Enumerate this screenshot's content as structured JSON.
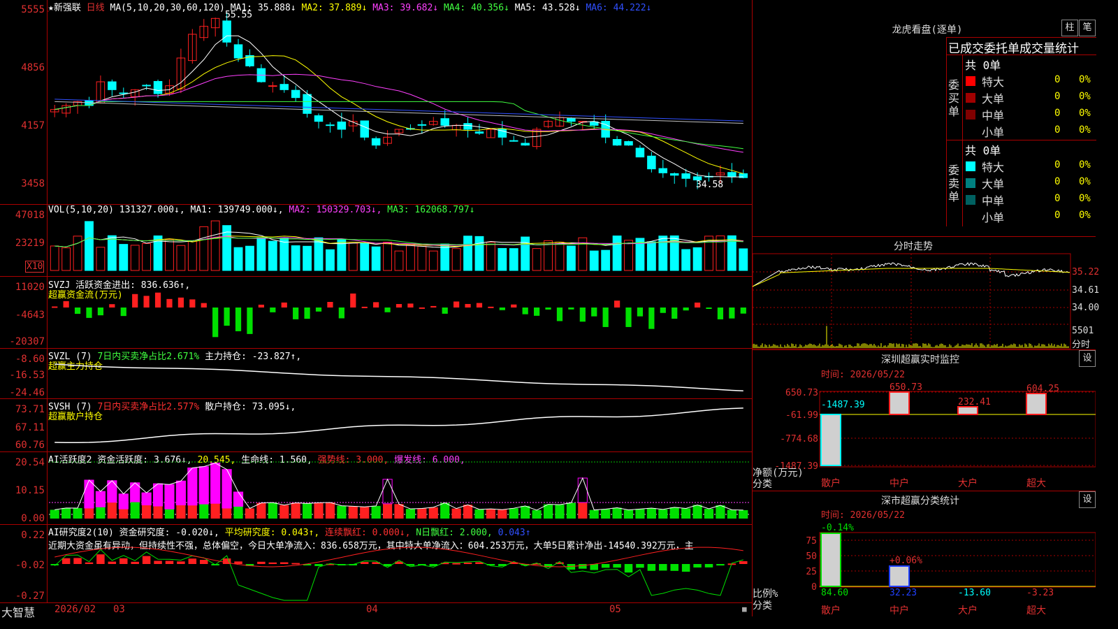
{
  "main_chart": {
    "stock_name": "★新强联",
    "period": "日线",
    "ma_header": "MA(5,10,20,30,60,120)",
    "ma1": "MA1: 35.888↓",
    "ma2": "MA2: 37.889↓",
    "ma3": "MA3: 39.682↓",
    "ma4": "MA4: 40.356↓",
    "ma5": "MA5: 43.528↓",
    "ma6": "MA6: 44.222↓",
    "y_ticks": [
      "5555",
      "4856",
      "4157",
      "3458"
    ],
    "high_label": "55.55",
    "low_label": "34.58"
  },
  "vol_panel": {
    "header": "VOL(5,10,20) 131327.000↓,",
    "ma1": "MA1: 139749.000↓,",
    "ma2": "MA2: 150329.703↓,",
    "ma3": "MA3: 162068.797↓",
    "y_ticks": [
      "47018",
      "23219"
    ],
    "unit": "X10"
  },
  "svzj_panel": {
    "header": "SVZJ  活跃资金进出: 836.636↑,",
    "sub": "超赢资金流(万元)",
    "y_ticks": [
      "11020",
      "-4643",
      "-20307"
    ]
  },
  "svzl_panel": {
    "header_prefix": "SVZL (7)",
    "header_green": "7日内买卖净占比2.671%",
    "header_white": "主力持仓: -23.827↑,",
    "sub": "超赢主力持仓",
    "y_ticks": [
      "-8.60",
      "-16.53",
      "-24.46"
    ]
  },
  "svsh_panel": {
    "header_prefix": "SVSH (7)",
    "header_red": "7日内买卖净占比2.577%",
    "header_white": "散户持仓: 73.095↓,",
    "sub": "超赢散户持仓",
    "y_ticks": [
      "73.71",
      "67.11",
      "60.76"
    ]
  },
  "ai_active_panel": {
    "header": "AI活跃度2 资金活跃度: 3.676↓,",
    "val2": "20.545,",
    "life": "生命线: 1.560,",
    "strong": "强势线: 3.000,",
    "burst": "爆发线: 6.000,",
    "y_ticks": [
      "20.54",
      "10.15",
      "0.00"
    ]
  },
  "ai_research_panel": {
    "header": "AI研究度2(10) 资金研究度: -0.020↓,",
    "avg": "平均研究度: 0.043↑,",
    "streak": "连续飘红: 0.000↓,",
    "nday": "N日飘红: 2.000,",
    "last": "0.043↑",
    "comment": "近期大资金虽有异动，但持续性不强，总体偏空，今日大单净流入：836.658万元，其中特大单净流入：604.253万元，大单5日累计净出-14540.392万元，主",
    "y_ticks": [
      "0.22",
      "-0.02",
      "-0.27"
    ]
  },
  "bottom_bar": {
    "brand": "大智慧",
    "date1": "2026/02",
    "date2": "03",
    "date3": "04",
    "date4": "05"
  },
  "right_panel": {
    "lhb_title": "龙虎看盘(逐单)",
    "btn_zhu": "柱",
    "btn_bi": "笔",
    "stats_title": "已成交委托单成交量统计",
    "buy_group_label": "委买单",
    "sell_group_label": "委卖单",
    "buy_total": "共 0单",
    "sell_total": "共 0单",
    "buy_rows": [
      {
        "label": "特大",
        "count": "0",
        "pct": "0%"
      },
      {
        "label": "大单",
        "count": "0",
        "pct": "0%"
      },
      {
        "label": "中单",
        "count": "0",
        "pct": "0%"
      },
      {
        "label": "小单",
        "count": "0",
        "pct": "0%"
      }
    ],
    "sell_rows": [
      {
        "label": "特大",
        "count": "0",
        "pct": "0%"
      },
      {
        "label": "大单",
        "count": "0",
        "pct": "0%"
      },
      {
        "label": "中单",
        "count": "0",
        "pct": "0%"
      },
      {
        "label": "小单",
        "count": "0",
        "pct": "0%"
      }
    ],
    "intraday_title": "分时走势",
    "intraday_y": [
      "35.22",
      "34.61",
      "34.00"
    ],
    "intraday_vol": "5501",
    "intraday_vol_unit": "分时",
    "sz_monitor_title": "深圳超赢实时监控",
    "sz_monitor_btn": "设",
    "sz_monitor_time": "时间: 2026/05/22",
    "sz_monitor_y": [
      "650.73",
      "-61.99",
      "-774.68",
      "-1487.39"
    ],
    "sz_monitor_axis_label": "净额(万元)",
    "sz_monitor_cat_label": "分类",
    "sz_monitor_bar_labels": [
      "-1487.39",
      "650.73",
      "232.41",
      "604.25"
    ],
    "sz_monitor_cats": [
      "散户",
      "中户",
      "大户",
      "超大"
    ],
    "sz_class_title": "深市超赢分类统计",
    "sz_class_btn": "设",
    "sz_class_time": "时间: 2026/05/22",
    "sz_class_y": [
      "75",
      "50",
      "25",
      "0"
    ],
    "sz_class_axis_label": "比例%",
    "sz_class_cat_label": "分类",
    "sz_class_top_labels": [
      "-0.14%",
      "+0.06%"
    ],
    "sz_class_values": [
      "84.60",
      "32.23",
      "-13.60",
      "-3.23"
    ],
    "sz_class_cats": [
      "散户",
      "中户",
      "大户",
      "超大"
    ]
  },
  "colors": {
    "up": "#ff2020",
    "down": "#00ffff",
    "green": "#00e000",
    "magenta": "#ff00ff",
    "yellow": "#ffff00",
    "grid": "#a00000"
  }
}
